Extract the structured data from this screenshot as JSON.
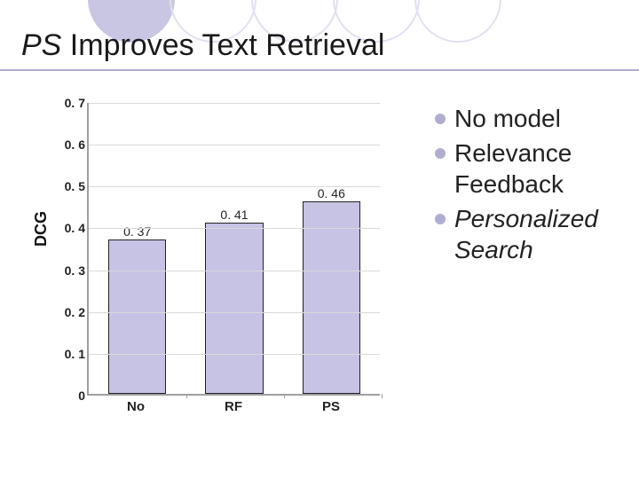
{
  "title_prefix": "PS",
  "title_rest": " Improves Text Retrieval",
  "bullets": [
    {
      "text": "No model",
      "italic": false
    },
    {
      "text": "Relevance Feedback",
      "italic": false
    },
    {
      "text": "Personalized Search",
      "italic": true
    }
  ],
  "chart_data": {
    "type": "bar",
    "ylabel": "DCG",
    "xlabel": "",
    "ylim": [
      0,
      0.7
    ],
    "yticks": [
      "0",
      "0. 1",
      "0. 2",
      "0. 3",
      "0. 4",
      "0. 5",
      "0. 6",
      "0. 7"
    ],
    "categories": [
      "No",
      "RF",
      "PS"
    ],
    "values": [
      0.37,
      0.41,
      0.46
    ],
    "value_labels": [
      "0. 37",
      "0. 41",
      "0. 46"
    ]
  }
}
